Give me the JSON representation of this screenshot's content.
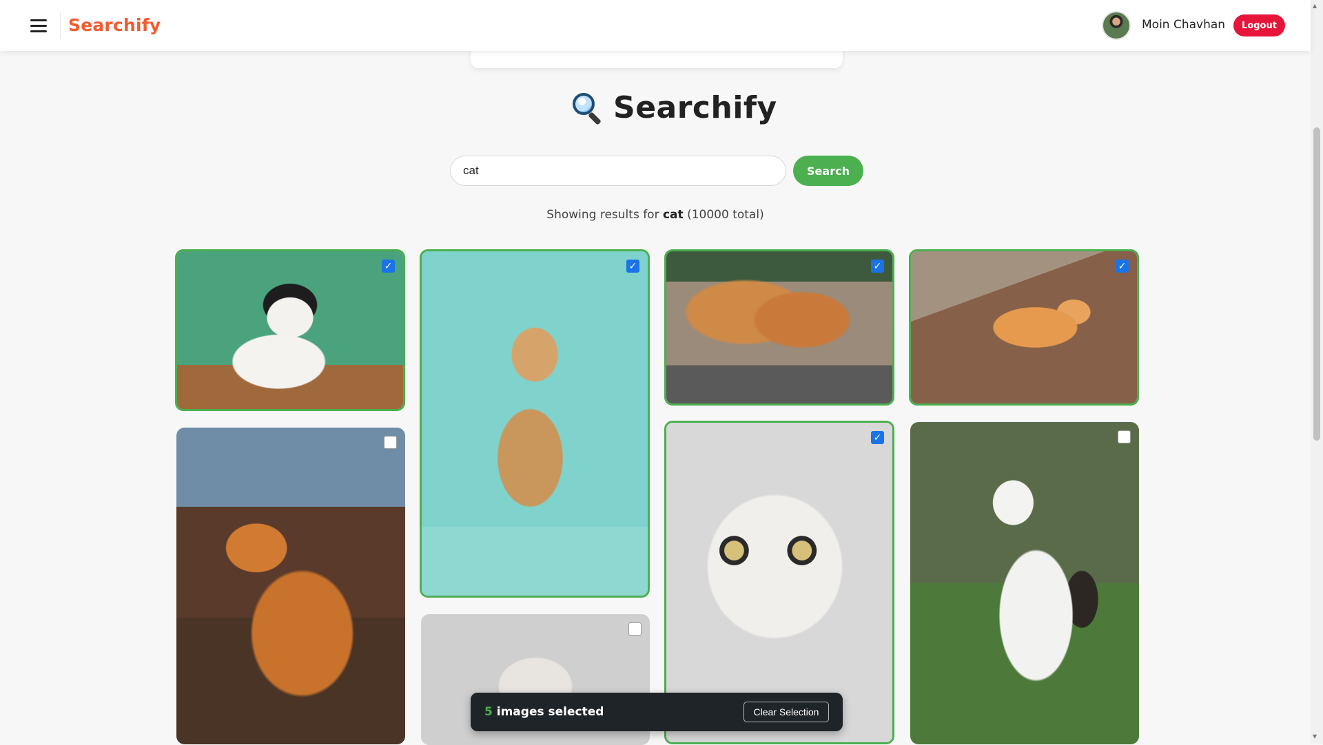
{
  "navbar": {
    "brand": "Searchify",
    "user_name": "Moin Chavhan",
    "logout_label": "Logout"
  },
  "hero": {
    "title": "Searchify",
    "icon": "magnifying-glass-icon"
  },
  "search": {
    "value": "cat",
    "placeholder": "",
    "button_label": "Search"
  },
  "results": {
    "prefix": "Showing results for",
    "query": "cat",
    "total": "(10000 total)"
  },
  "images": [
    {
      "name": "cat-image-1",
      "selected": true
    },
    {
      "name": "cat-image-2",
      "selected": true
    },
    {
      "name": "cat-image-3",
      "selected": true
    },
    {
      "name": "cat-image-4",
      "selected": true
    },
    {
      "name": "cat-image-5",
      "selected": false
    },
    {
      "name": "cat-image-6",
      "selected": false
    },
    {
      "name": "cat-image-7",
      "selected": true
    },
    {
      "name": "cat-image-8",
      "selected": false
    }
  ],
  "selection_bar": {
    "count": "5",
    "label": "images selected",
    "clear_label": "Clear Selection"
  },
  "colors": {
    "brand": "#f35b31",
    "accent_green": "#4caf50",
    "logout_red": "#e5163a",
    "checkbox_blue": "#1a73e8"
  }
}
